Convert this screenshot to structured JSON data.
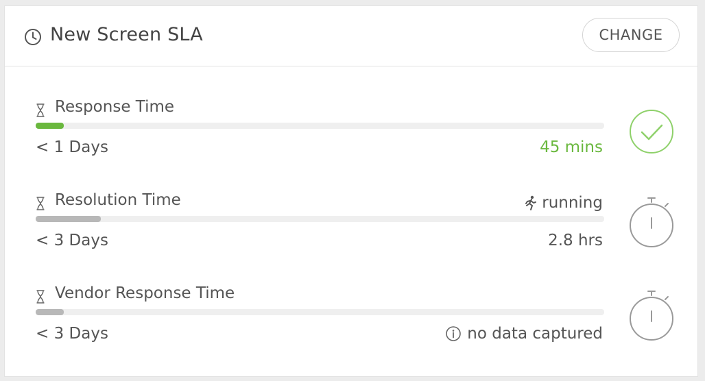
{
  "header": {
    "title": "New Screen SLA",
    "icon": "clock-icon",
    "change_label": "CHANGE"
  },
  "colors": {
    "success": "#6ab83e",
    "neutral_bar": "#b8b8b8",
    "track": "#efefef",
    "icon_gray": "#9a9a9a"
  },
  "metrics": [
    {
      "label": "Response Time",
      "icon": "hourglass-icon",
      "status": "",
      "target": "< 1 Days",
      "value": "45 mins",
      "value_state": "success",
      "progress": 0.05,
      "bar_color": "#6ab83e",
      "state_icon": "check-circle-icon"
    },
    {
      "label": "Resolution Time",
      "icon": "hourglass-icon",
      "status": "running",
      "status_icon": "runner-icon",
      "target": "< 3 Days",
      "value": "2.8 hrs",
      "value_state": "normal",
      "progress": 0.115,
      "bar_color": "#b8b8b8",
      "state_icon": "stopwatch-icon"
    },
    {
      "label": "Vendor Response Time",
      "icon": "hourglass-icon",
      "status": "",
      "target": "< 3 Days",
      "value": "no data captured",
      "value_icon": "info-icon",
      "value_state": "normal",
      "progress": 0.05,
      "bar_color": "#b8b8b8",
      "state_icon": "stopwatch-icon"
    }
  ]
}
